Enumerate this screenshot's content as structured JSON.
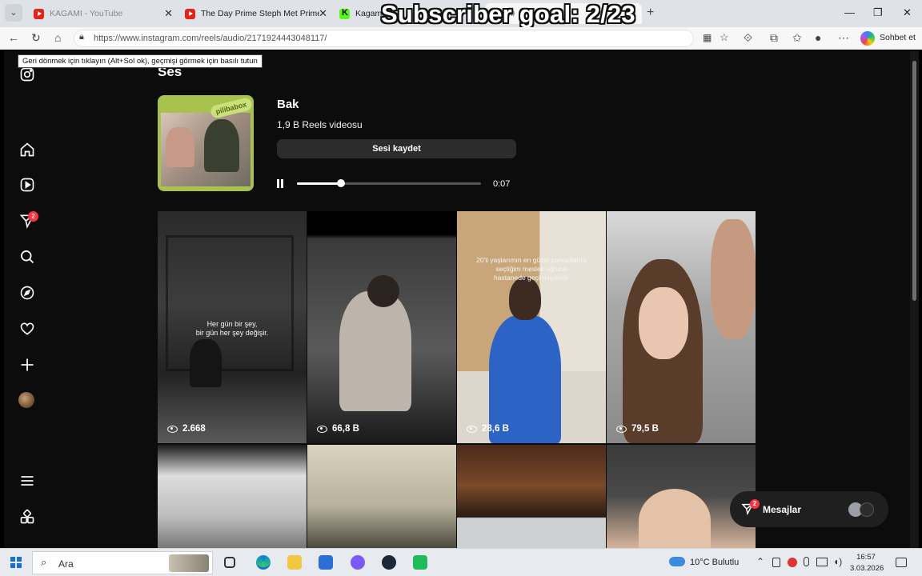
{
  "browser": {
    "tabs": [
      {
        "title": "KAGAMI - YouTube",
        "icon": "youtube-icon",
        "active": false
      },
      {
        "title": "The Day Prime Steph Met Prime Le",
        "icon": "youtube-icon",
        "active": false
      },
      {
        "title": "Kagami_",
        "icon": "kick-icon",
        "active": false
      },
      {
        "title": "",
        "icon": "instagram-icon",
        "active": true
      }
    ],
    "overlay_text": "Subscriber goal: 2/23",
    "url": "https://www.instagram.com/reels/audio/2171924443048117/",
    "copilot_label": "Sohbet et",
    "back_tooltip": "Geri dönmek için tıklayın (Alt+Sol ok), geçmişi görmek için basılı tutun"
  },
  "sidebar": {
    "notifications_badge": "2",
    "items": [
      "instagram-logo-icon",
      "home-icon",
      "reels-icon",
      "messages-icon",
      "search-icon",
      "explore-icon",
      "heart-icon",
      "create-icon",
      "profile-avatar",
      "menu-icon",
      "also-from-meta-icon"
    ]
  },
  "audio": {
    "section_title": "Ses",
    "name": "Bak",
    "reel_count": "1,9 B Reels videosu",
    "save_label": "Sesi kaydet",
    "cover_logo": "pilibabox",
    "time": "0:07",
    "progress": 0.24
  },
  "grid": [
    {
      "views": "2.668",
      "overlay": "Her gün bir şey,\nbir gün her şey değişir."
    },
    {
      "views": "66,8 B",
      "overlay": ""
    },
    {
      "views": "28,6 B",
      "overlay": "20'li yaşlarımın en güzel zamanlarını\nseçtiğim meslek uğruna\nhastanede geçirmişsindir"
    },
    {
      "views": "79,5 B",
      "overlay": ""
    },
    {
      "views": "",
      "overlay": ""
    },
    {
      "views": "",
      "overlay": ""
    },
    {
      "views": "",
      "overlay": ""
    },
    {
      "views": "",
      "overlay": ""
    }
  ],
  "messages": {
    "label": "Mesajlar",
    "badge": "2"
  },
  "taskbar": {
    "search_label": "Ara",
    "weather": "10°C  Bulutlu",
    "time": "16:57",
    "date": "3.03.2026"
  },
  "colors": {
    "page_bg": "#0c0c0c",
    "badge_red": "#ff3040",
    "button_dark": "#2c2c2c"
  }
}
